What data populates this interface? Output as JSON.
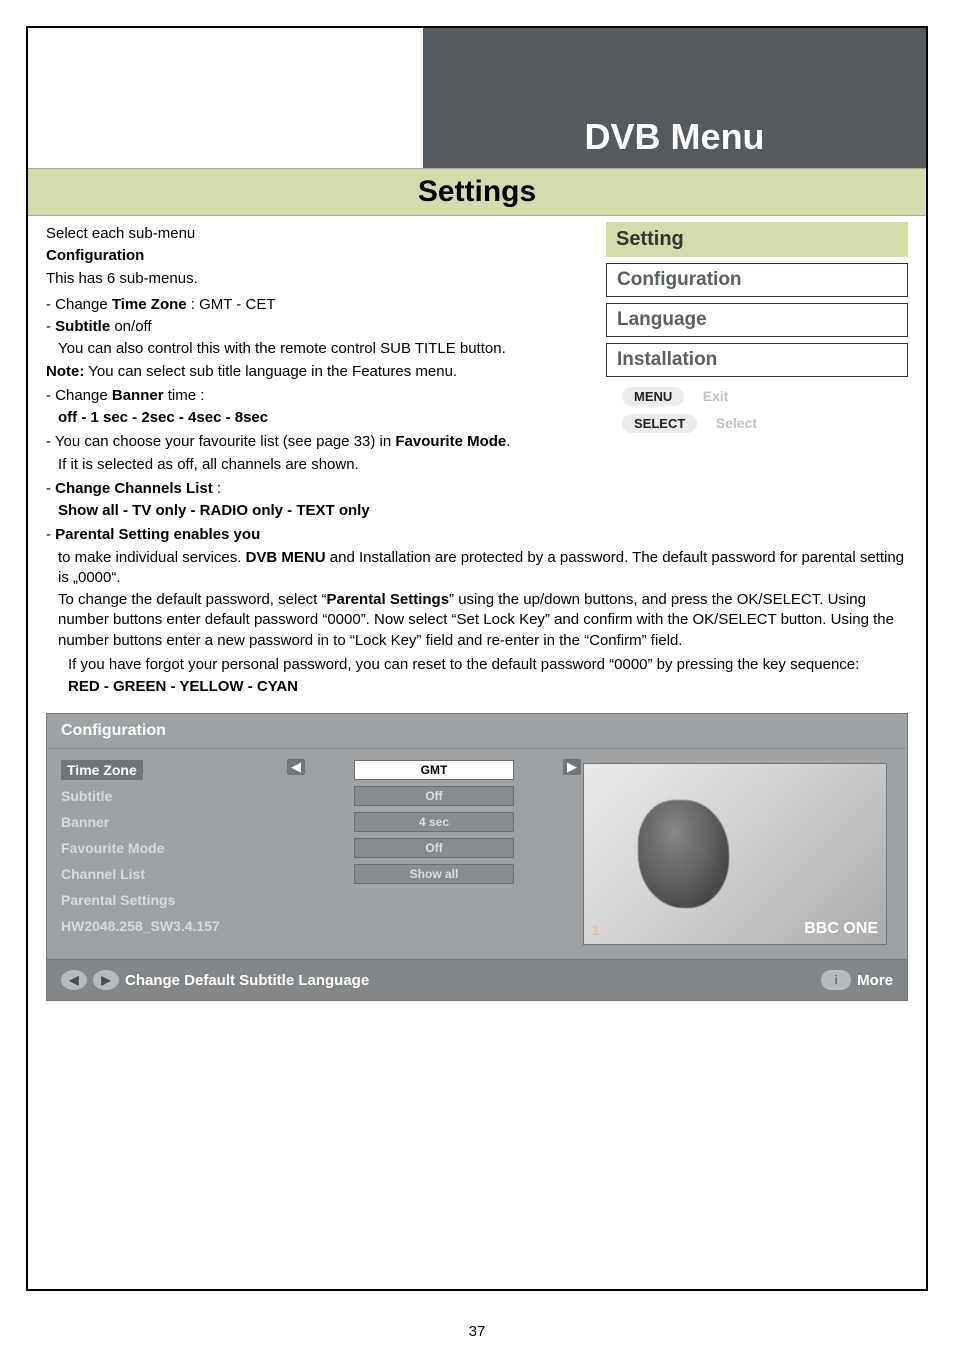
{
  "header": {
    "dvb_menu": "DVB Menu",
    "settings_bar": "Settings"
  },
  "text": {
    "select_sub": "Select each sub-menu",
    "config_hdr": "Configuration",
    "config_sub": "This has 6 sub-menus.",
    "tz_line_pre": "- Change ",
    "tz_bold": "Time Zone",
    "tz_line_post": " : GMT - CET",
    "subtitle_pre": "- ",
    "subtitle_bold": "Subtitle",
    "subtitle_post": " on/off",
    "subtitle_note": "You can also control this with the remote control SUB TITLE button.",
    "note_pre": "Note:",
    "note_body": " You can select sub title language in the Features menu.",
    "banner_pre": "- Change ",
    "banner_bold": "Banner",
    "banner_post": " time :",
    "banner_opts": "off - 1 sec - 2sec - 4sec - 8sec",
    "fav_pre": "- You can choose your favourite list (see page 33) in ",
    "fav_bold": "Favourite Mode",
    "fav_post": ".",
    "fav_off": "If it is selected as off, all channels are shown.",
    "ccl_pre": "- ",
    "ccl_bold": "Change Channels List",
    "ccl_post": " :",
    "ccl_opts": "Show all - TV only - RADIO only - TEXT only",
    "pse_pre": "- ",
    "pse_bold": "Parental Setting enables you",
    "pse_line1a": "to make individual services. ",
    "pse_line1b": "DVB MENU",
    "pse_line1c": " and Installation are protected by a password. The default password for parental setting is „0000“.",
    "pse_line2a": "To change the default password, select “",
    "pse_line2b": "Parental Settings",
    "pse_line2c": "” using the up/down buttons, and press the OK/SELECT. Using number buttons enter default password “0000”. Now select “Set Lock Key” and confirm with the OK/SELECT button. Using the number buttons enter a new password in to “Lock Key” field and re-enter in the “Confirm” field.",
    "pse_forgot": "If you have forgot your personal password, you can reset to the default password “0000” by pressing the key sequence:",
    "colors": "RED - GREEN - YELLOW - CYAN"
  },
  "setting_panel": {
    "title": "Setting",
    "items": [
      "Configuration",
      "Language",
      "Installation"
    ],
    "menu_pill": "MENU",
    "menu_label": "Exit",
    "select_pill": "SELECT",
    "select_label": "Select"
  },
  "osd": {
    "title": "Configuration",
    "rows": [
      {
        "label": "Time Zone",
        "value": "GMT",
        "highlight": true
      },
      {
        "label": "Subtitle",
        "value": "Off"
      },
      {
        "label": "Banner",
        "value": "4 sec"
      },
      {
        "label": "Favourite Mode",
        "value": "Off"
      },
      {
        "label": "Channel List",
        "value": "Show all"
      },
      {
        "label": "Parental Settings",
        "value": ""
      },
      {
        "label": "HW2048.258_SW3.4.157",
        "value": ""
      }
    ],
    "preview_num": "1",
    "preview_channel": "BBC ONE",
    "footer_left": "Change Default Subtitle Language",
    "footer_right_i": "i",
    "footer_right": "More"
  },
  "page_number": "37"
}
